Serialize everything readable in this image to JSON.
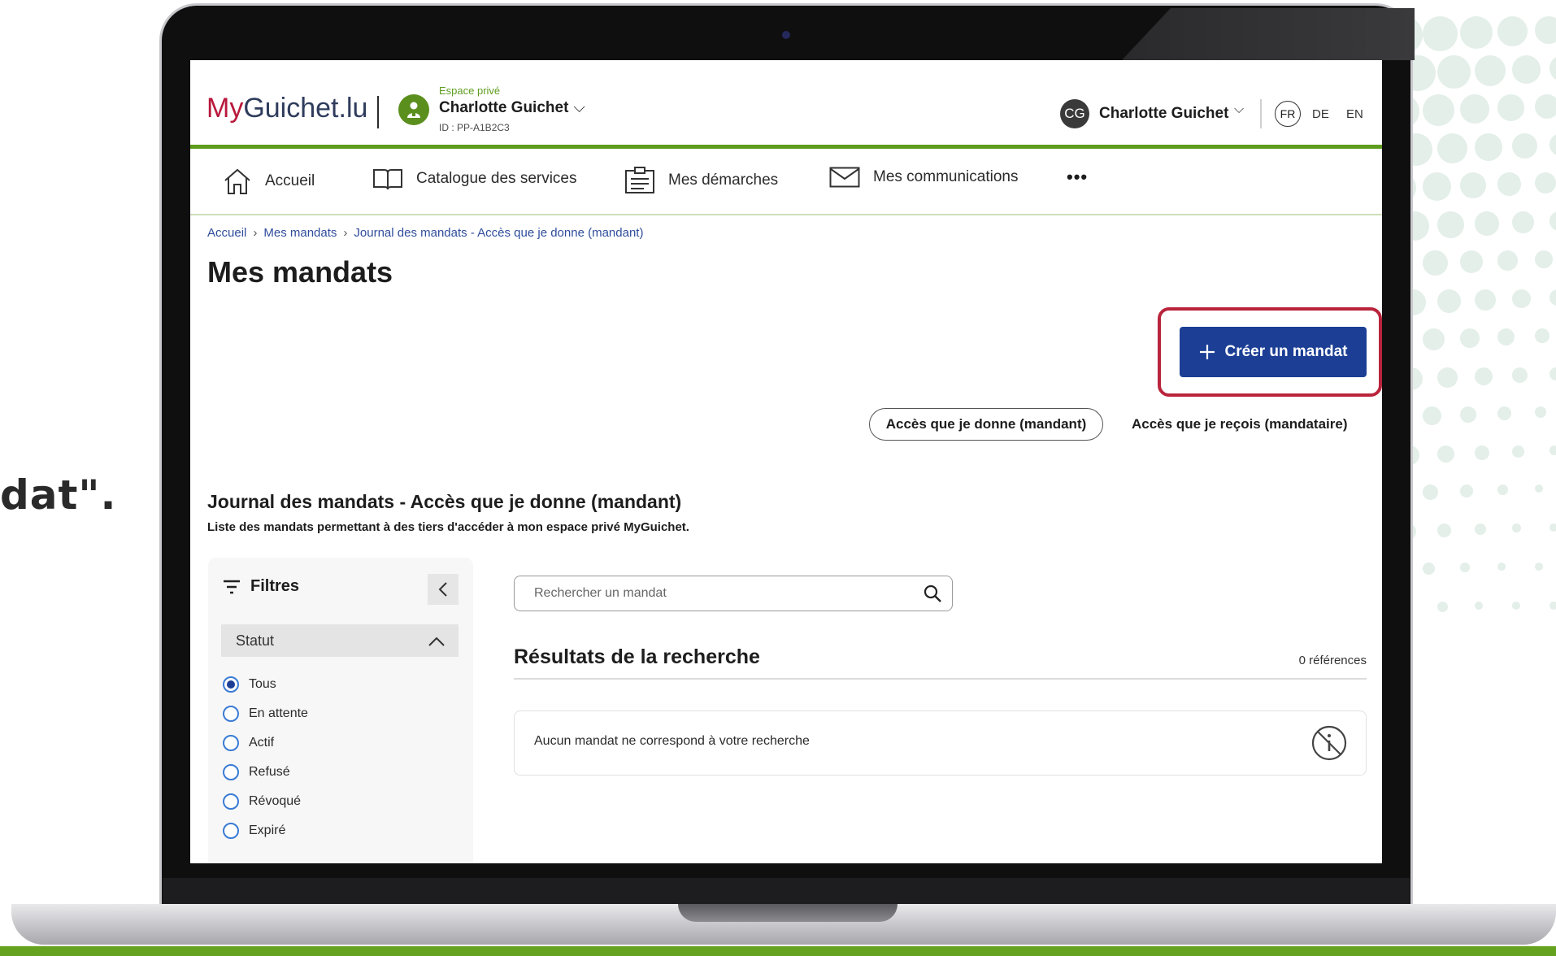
{
  "side_text": "dat\".",
  "header": {
    "logo_my": "My",
    "logo_rest": "Guichet.lu",
    "space_label": "Espace privé",
    "space_name": "Charlotte Guichet",
    "space_id": "ID : PP-A1B2C3",
    "avatar_initials": "CG",
    "user_name": "Charlotte Guichet",
    "languages": [
      "FR",
      "DE",
      "EN"
    ],
    "active_language": "FR"
  },
  "nav": {
    "items": [
      {
        "label": "Accueil",
        "icon": "home-icon"
      },
      {
        "label": "Catalogue des services",
        "icon": "book-icon"
      },
      {
        "label": "Mes démarches",
        "icon": "clipboard-icon"
      },
      {
        "label": "Mes communications",
        "icon": "mail-icon"
      }
    ],
    "more_label": "•••"
  },
  "breadcrumb": [
    "Accueil",
    "Mes mandats",
    "Journal des mandats - Accès que je donne (mandant)"
  ],
  "page_title": "Mes mandats",
  "create_button": {
    "label": "Créer un mandat",
    "icon": "plus-icon"
  },
  "tabs": {
    "active": "Accès que je donne (mandant)",
    "inactive": "Accès que je reçois (mandataire)"
  },
  "section": {
    "title": "Journal des mandats - Accès que je donne (mandant)",
    "subtitle": "Liste des mandats permettant à des tiers d'accéder à mon espace privé MyGuichet."
  },
  "filters": {
    "title": "Filtres",
    "group_label": "Statut",
    "options": [
      "Tous",
      "En attente",
      "Actif",
      "Refusé",
      "Révoqué",
      "Expiré"
    ],
    "selected": "Tous"
  },
  "search": {
    "placeholder": "Rechercher un mandat"
  },
  "results": {
    "title": "Résultats de la recherche",
    "count": "0 références",
    "empty_message": "Aucun mandat ne correspond à votre recherche"
  },
  "colors": {
    "brand_green": "#5e9c1e",
    "brand_red": "#b8193b",
    "primary_blue": "#1c3f95",
    "highlight_red": "#b9243c"
  }
}
